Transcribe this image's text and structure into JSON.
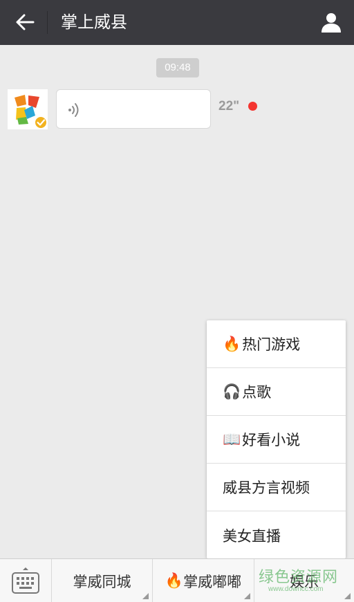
{
  "header": {
    "title": "掌上威县",
    "back_icon": "arrow-left-icon",
    "profile_icon": "person-icon"
  },
  "chat": {
    "timestamp": "09:48",
    "messages": [
      {
        "type": "voice",
        "duration": "22\"",
        "unread": true
      }
    ]
  },
  "popup_menu": {
    "items": [
      {
        "icon": "fire-emoji",
        "emoji": "🔥",
        "label": "热门游戏"
      },
      {
        "icon": "headphones-music-emoji",
        "emoji": "🎧",
        "label": "点歌"
      },
      {
        "icon": "open-book-emoji",
        "emoji": "📖",
        "label": "好看小说"
      },
      {
        "icon": "",
        "emoji": "",
        "label": "威县方言视频"
      },
      {
        "icon": "",
        "emoji": "",
        "label": "美女直播"
      }
    ]
  },
  "bottom_menu": {
    "keyboard_icon": "keyboard-icon",
    "tabs": [
      {
        "label": "掌威同城",
        "emoji": ""
      },
      {
        "label": "掌威嘟嘟",
        "emoji": "🔥"
      },
      {
        "label": "娱乐",
        "emoji": ""
      }
    ]
  },
  "watermark": {
    "main": "绿色资源网",
    "sub": "www.downcc.com"
  },
  "colors": {
    "header_bg": "#3a3a3f",
    "chat_bg": "#ebebeb",
    "unread_dot": "#f43530",
    "watermark": "#63b86d"
  }
}
